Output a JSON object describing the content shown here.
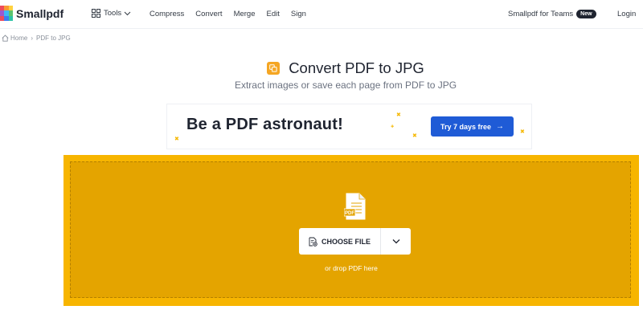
{
  "header": {
    "brand": "Smallpdf",
    "tools_label": "Tools",
    "nav": [
      {
        "label": "Compress",
        "name": "nav-compress"
      },
      {
        "label": "Convert",
        "name": "nav-convert"
      },
      {
        "label": "Merge",
        "name": "nav-merge"
      },
      {
        "label": "Edit",
        "name": "nav-edit"
      },
      {
        "label": "Sign",
        "name": "nav-sign"
      }
    ],
    "teams_label": "Smallpdf for Teams",
    "teams_badge": "New",
    "login_label": "Login"
  },
  "breadcrumb": {
    "home": "Home",
    "separator": "›",
    "current": "PDF to JPG"
  },
  "hero": {
    "title": "Convert PDF to JPG",
    "subtitle": "Extract images or save each page from PDF to JPG"
  },
  "promo": {
    "headline": "Be a PDF astronaut!",
    "cta": "Try 7 days free",
    "cta_arrow": "→"
  },
  "dropzone": {
    "file_label": "PDF",
    "choose_label": "CHOOSE FILE",
    "hint": "or drop PDF here"
  },
  "colors": {
    "accent_blue": "#1f5bd6",
    "tool_orange": "#f5a623",
    "dropzone_outer": "#f7b500",
    "dropzone_inner": "#e4a400"
  },
  "icons": [
    "smallpdf-logo-icon",
    "grid-icon",
    "chevron-down-icon",
    "home-icon",
    "pdf-to-jpg-icon",
    "pdf-file-icon",
    "file-add-icon",
    "star-icon"
  ]
}
